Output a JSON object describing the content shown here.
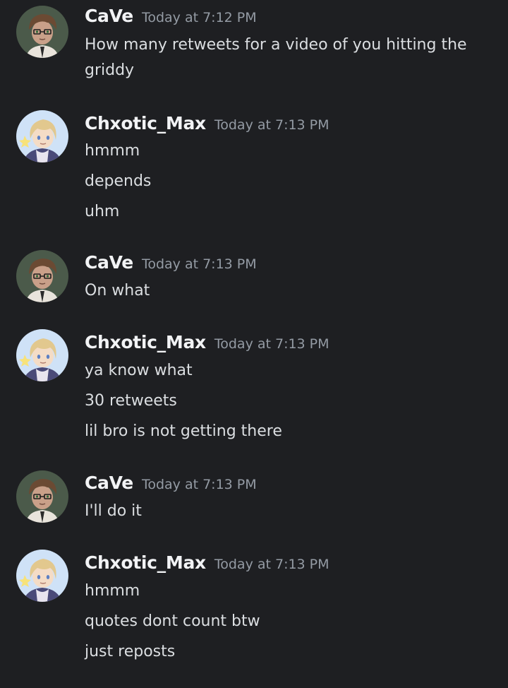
{
  "colors": {
    "background": "#1e1f22",
    "username": "#f2f3f5",
    "timestamp": "#949ba4",
    "message_text": "#dbdee1"
  },
  "messages": [
    {
      "author": "CaVe",
      "avatar": "cave-avatar",
      "time": "Today at 7:12 PM",
      "lines": [
        "How many retweets for a video of you hitting the",
        "griddy"
      ]
    },
    {
      "author": "Chxotic_Max",
      "avatar": "chxotic-max-avatar",
      "time": "Today at 7:13 PM",
      "lines": [
        "hmmm",
        "depends",
        "uhm"
      ]
    },
    {
      "author": "CaVe",
      "avatar": "cave-avatar",
      "time": "Today at 7:13 PM",
      "lines": [
        "On what"
      ]
    },
    {
      "author": "Chxotic_Max",
      "avatar": "chxotic-max-avatar",
      "time": "Today at 7:13 PM",
      "lines": [
        "ya know what",
        "30 retweets",
        "lil bro is not getting there"
      ]
    },
    {
      "author": "CaVe",
      "avatar": "cave-avatar",
      "time": "Today at 7:13 PM",
      "lines": [
        "I'll do it"
      ]
    },
    {
      "author": "Chxotic_Max",
      "avatar": "chxotic-max-avatar",
      "time": "Today at 7:13 PM",
      "lines": [
        "hmmm",
        "quotes dont count btw",
        "just reposts"
      ]
    }
  ]
}
